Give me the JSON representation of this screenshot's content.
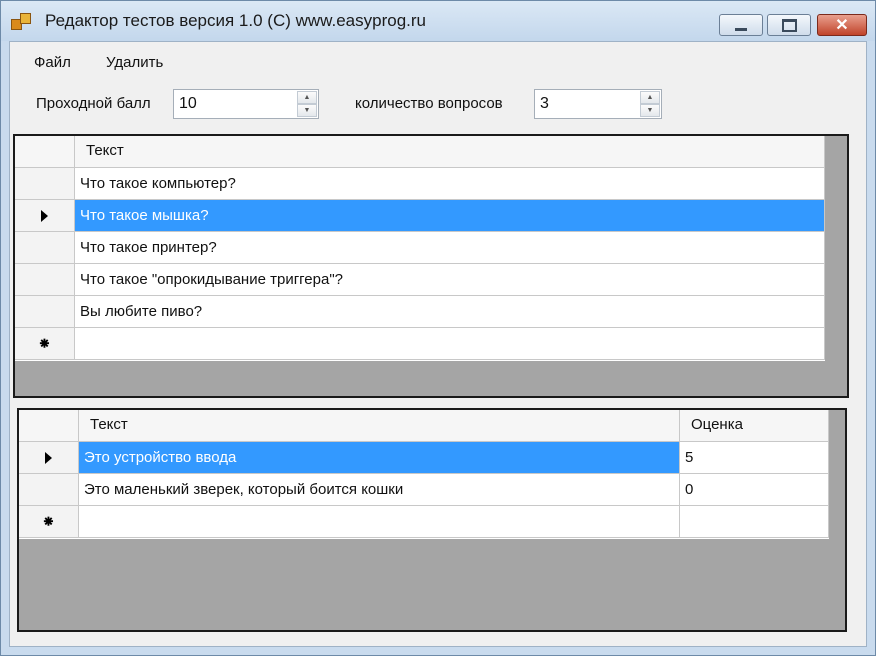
{
  "window": {
    "title": "Редактор тестов версия 1.0 (С) www.easyprog.ru",
    "close_glyph": "✕"
  },
  "menu": {
    "file": "Файл",
    "delete": "Удалить"
  },
  "settings": {
    "passing_score_label": "Проходной балл",
    "passing_score_value": "10",
    "question_count_label": "количество вопросов",
    "question_count_value": "3"
  },
  "questions_grid": {
    "header": {
      "text": "Текст"
    },
    "rows": [
      {
        "text": "Что такое компьютер?"
      },
      {
        "text": "Что такое мышка?"
      },
      {
        "text": "Что такое принтер?"
      },
      {
        "text": "Что такое \"опрокидывание триггера\"?"
      },
      {
        "text": "Вы любите пиво?"
      }
    ],
    "selected_index": 1,
    "new_row_glyph": "⁕"
  },
  "answers_grid": {
    "header": {
      "text": "Текст",
      "score": "Оценка"
    },
    "rows": [
      {
        "text": "Это устройство ввода",
        "score": "5"
      },
      {
        "text": "Это маленький зверек, который боится кошки",
        "score": "0"
      }
    ],
    "selected_index": 0,
    "new_row_glyph": "⁕"
  },
  "icons": {
    "app": "app-icon",
    "row_selector": "current-row-arrow-icon",
    "new_row": "new-row-asterisk-icon"
  },
  "colors": {
    "selection": "#3399ff",
    "grid_background": "#a5a5a5",
    "title_bar": "#c9dbee"
  }
}
